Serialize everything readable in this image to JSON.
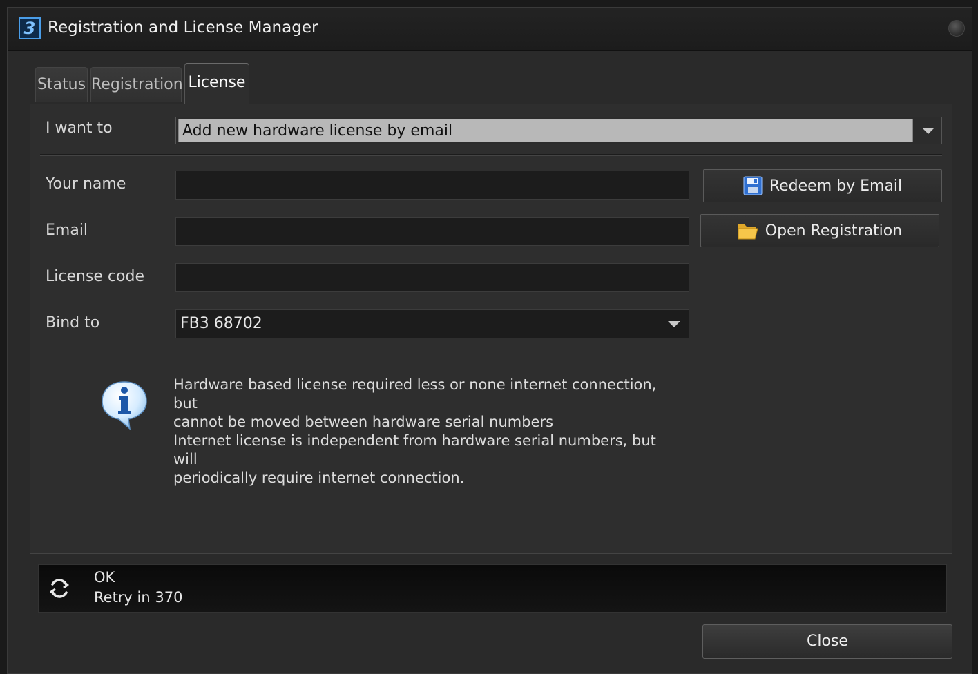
{
  "window": {
    "title": "Registration and License Manager",
    "app_icon": "3"
  },
  "tabs": [
    {
      "label": "Status",
      "active": false
    },
    {
      "label": "Registration",
      "active": false
    },
    {
      "label": "License",
      "active": true
    }
  ],
  "form": {
    "i_want_to_label": "I want to",
    "i_want_to_value": "Add new hardware license by email",
    "your_name_label": "Your name",
    "your_name_value": "",
    "email_label": "Email",
    "email_value": "",
    "license_code_label": "License code",
    "license_code_value": "",
    "bind_to_label": "Bind to",
    "bind_to_value": "FB3 68702"
  },
  "buttons": {
    "redeem_label": "Redeem by Email",
    "redeem_icon": "floppy-disk-icon",
    "open_label": "Open Registration",
    "open_icon": "folder-open-icon",
    "close_label": "Close"
  },
  "info": {
    "icon": "info-bubble-icon",
    "line1": "Hardware based license required less or none internet connection, but",
    "line2": "cannot be moved between hardware serial numbers",
    "line3": "Internet license is independent from hardware serial numbers, but will",
    "line4": "periodically require internet connection."
  },
  "status": {
    "icon": "refresh-icon",
    "state": "OK",
    "retry": "Retry in 370"
  },
  "colors": {
    "background": "#2e2e2e",
    "titlebar": "#1c1c1c",
    "accent_blue": "#4a9de8",
    "selection_gray": "#b8b8b8"
  }
}
